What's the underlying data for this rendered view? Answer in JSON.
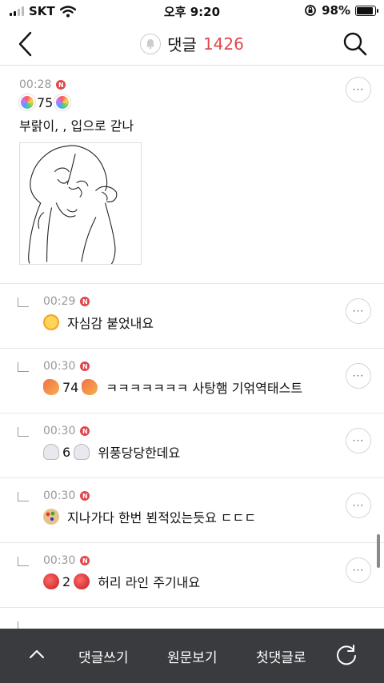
{
  "status_bar": {
    "carrier": "SKT",
    "time": "오후 9:20",
    "battery": "98%"
  },
  "header": {
    "title": "댓글",
    "count": "1426"
  },
  "comments": [
    {
      "time": "00:28",
      "badge": "N",
      "level": "75",
      "level_icon": "lollipop-icon",
      "text": "부랅이, , 입으로 갇나",
      "has_drawing": true
    },
    {
      "time": "00:29",
      "badge": "N",
      "icon": "sun-icon",
      "text": "자심감 붙었내요"
    },
    {
      "time": "00:30",
      "badge": "N",
      "level": "74",
      "level_icon": "shrimp-icon",
      "text": "ㅋㅋㅋㅋㅋㅋㅋ 사탕햄 기얶역태스트"
    },
    {
      "time": "00:30",
      "badge": "N",
      "level": "6",
      "level_icon": "ghost-icon",
      "text": "위풍당당한데요"
    },
    {
      "time": "00:30",
      "badge": "N",
      "icon": "palette-icon",
      "text": "지나가다 한번 뵌적있는듯요 ㄷㄷㄷ"
    },
    {
      "time": "00:30",
      "badge": "N",
      "level": "2",
      "level_icon": "apple-icon",
      "text": "허리 라인 주기내요"
    }
  ],
  "more_label": "···",
  "bottom_bar": {
    "write": "댓글쓰기",
    "original": "원문보기",
    "first": "첫댓글로"
  },
  "colors": {
    "accent": "#e0464b",
    "bottom_bar": "#3a3b3f"
  }
}
